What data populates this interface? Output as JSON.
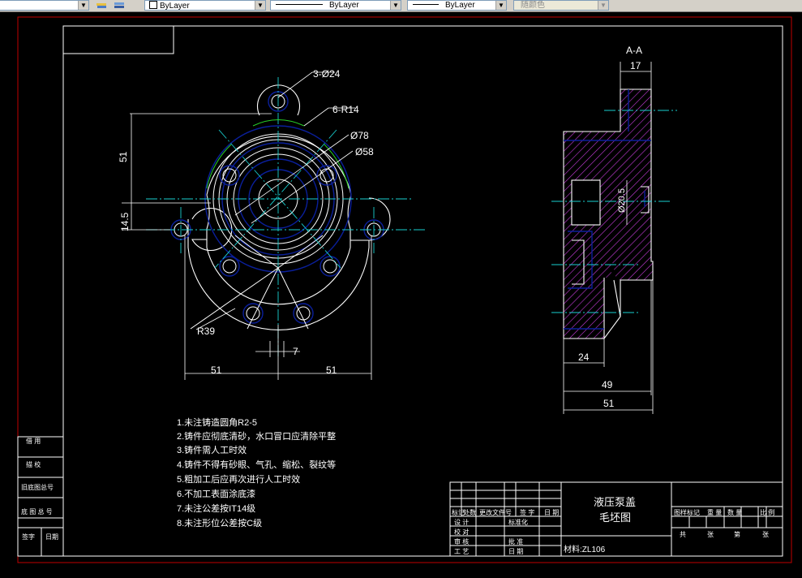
{
  "toolbar": {
    "layer_combo": "ByLayer",
    "linetype_combo": "ByLayer",
    "lineweight_combo": "ByLayer",
    "color_combo": "随颜色",
    "dropdown_arrow": "▼"
  },
  "drawing": {
    "section_label": "A-A",
    "dims": {
      "d_17": "17",
      "holes_3": "3-Ø24",
      "radius_6": "6-R14",
      "dia_78": "Ø78",
      "dia_58": "Ø58",
      "v_51": "51",
      "v_145": "14.5",
      "r_39": "R39",
      "d_7": "7",
      "h_51_left": "51",
      "h_51_right": "51",
      "bore": "Ø20.5",
      "d_24": "24",
      "d_49": "49",
      "d_51_side": "51"
    },
    "notes": [
      "1.未注铸造圆角R2-5",
      "2.铸件应彻底清砂，水口冒口应清除平整",
      "3.铸件需人工时效",
      "4.铸件不得有砂眼、气孔、缩松、裂纹等",
      "5.粗加工后应再次进行人工时效",
      "6.不加工表面涂底漆",
      "7.未注公差按IT14级",
      "8.未注形位公差按C级"
    ],
    "left_strip": [
      "借 用",
      "描 校",
      "旧底图总号",
      "底 图 总 号",
      "签字",
      "日期"
    ],
    "title_block": {
      "part_name": "液压泵盖",
      "drawing_name": "毛坯图",
      "material": "材料:ZL106",
      "row_mark": "标记",
      "row_qty": "处数",
      "row_file": "更改文件号",
      "row_sign": "签 字",
      "row_date": "日 期",
      "design": "设 计",
      "check": "校 对",
      "review": "审 核",
      "process": "工 艺",
      "standard": "标准化",
      "approve": "批 准",
      "date": "日 期",
      "stage": "图样标记",
      "weight": "重 量",
      "qty": "数 量",
      "scale": "比 例",
      "total": "共",
      "sheets": "张",
      "page": "第",
      "page_unit": "张"
    }
  }
}
